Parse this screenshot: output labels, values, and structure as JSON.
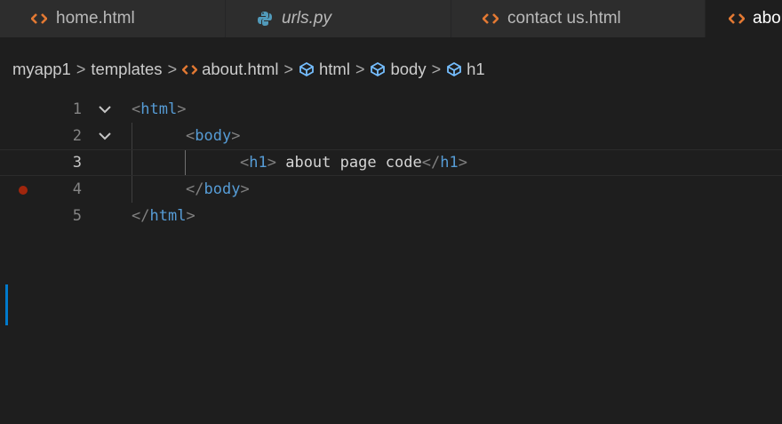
{
  "tabs": [
    {
      "label": "home.html",
      "icon": "html-brackets-icon",
      "italic": false,
      "active": false
    },
    {
      "label": "urls.py",
      "icon": "python-icon",
      "italic": true,
      "active": false
    },
    {
      "label": "contact us.html",
      "icon": "html-brackets-icon",
      "italic": false,
      "active": false
    },
    {
      "label": "about.html",
      "icon": "html-brackets-icon",
      "italic": false,
      "active": true
    }
  ],
  "breadcrumb": {
    "items": [
      "myapp1",
      "templates",
      "about.html",
      "html",
      "body",
      "h1"
    ],
    "separator": ">"
  },
  "editor": {
    "lines": [
      {
        "number": "1",
        "open": "<",
        "tag": "html",
        "close": ">",
        "text": ""
      },
      {
        "number": "2",
        "open": "<",
        "tag": "body",
        "close": ">",
        "text": ""
      },
      {
        "number": "3",
        "open": "<",
        "tag": "h1",
        "close": ">",
        "text": " about page code",
        "end_open": "</",
        "end_tag": "h1",
        "end_close": ">"
      },
      {
        "number": "4",
        "open": "</",
        "tag": "body",
        "close": ">",
        "text": ""
      },
      {
        "number": "5",
        "open": "</",
        "tag": "html",
        "close": ">",
        "text": ""
      }
    ],
    "current_line": "3",
    "breakpoint_line": "4"
  },
  "colors": {
    "html_icon": "#e37933",
    "python_icon": "#519aba",
    "element_icon": "#75beff",
    "tag": "#569cd6",
    "bracket": "#808080",
    "breakpoint": "#a1260d"
  }
}
